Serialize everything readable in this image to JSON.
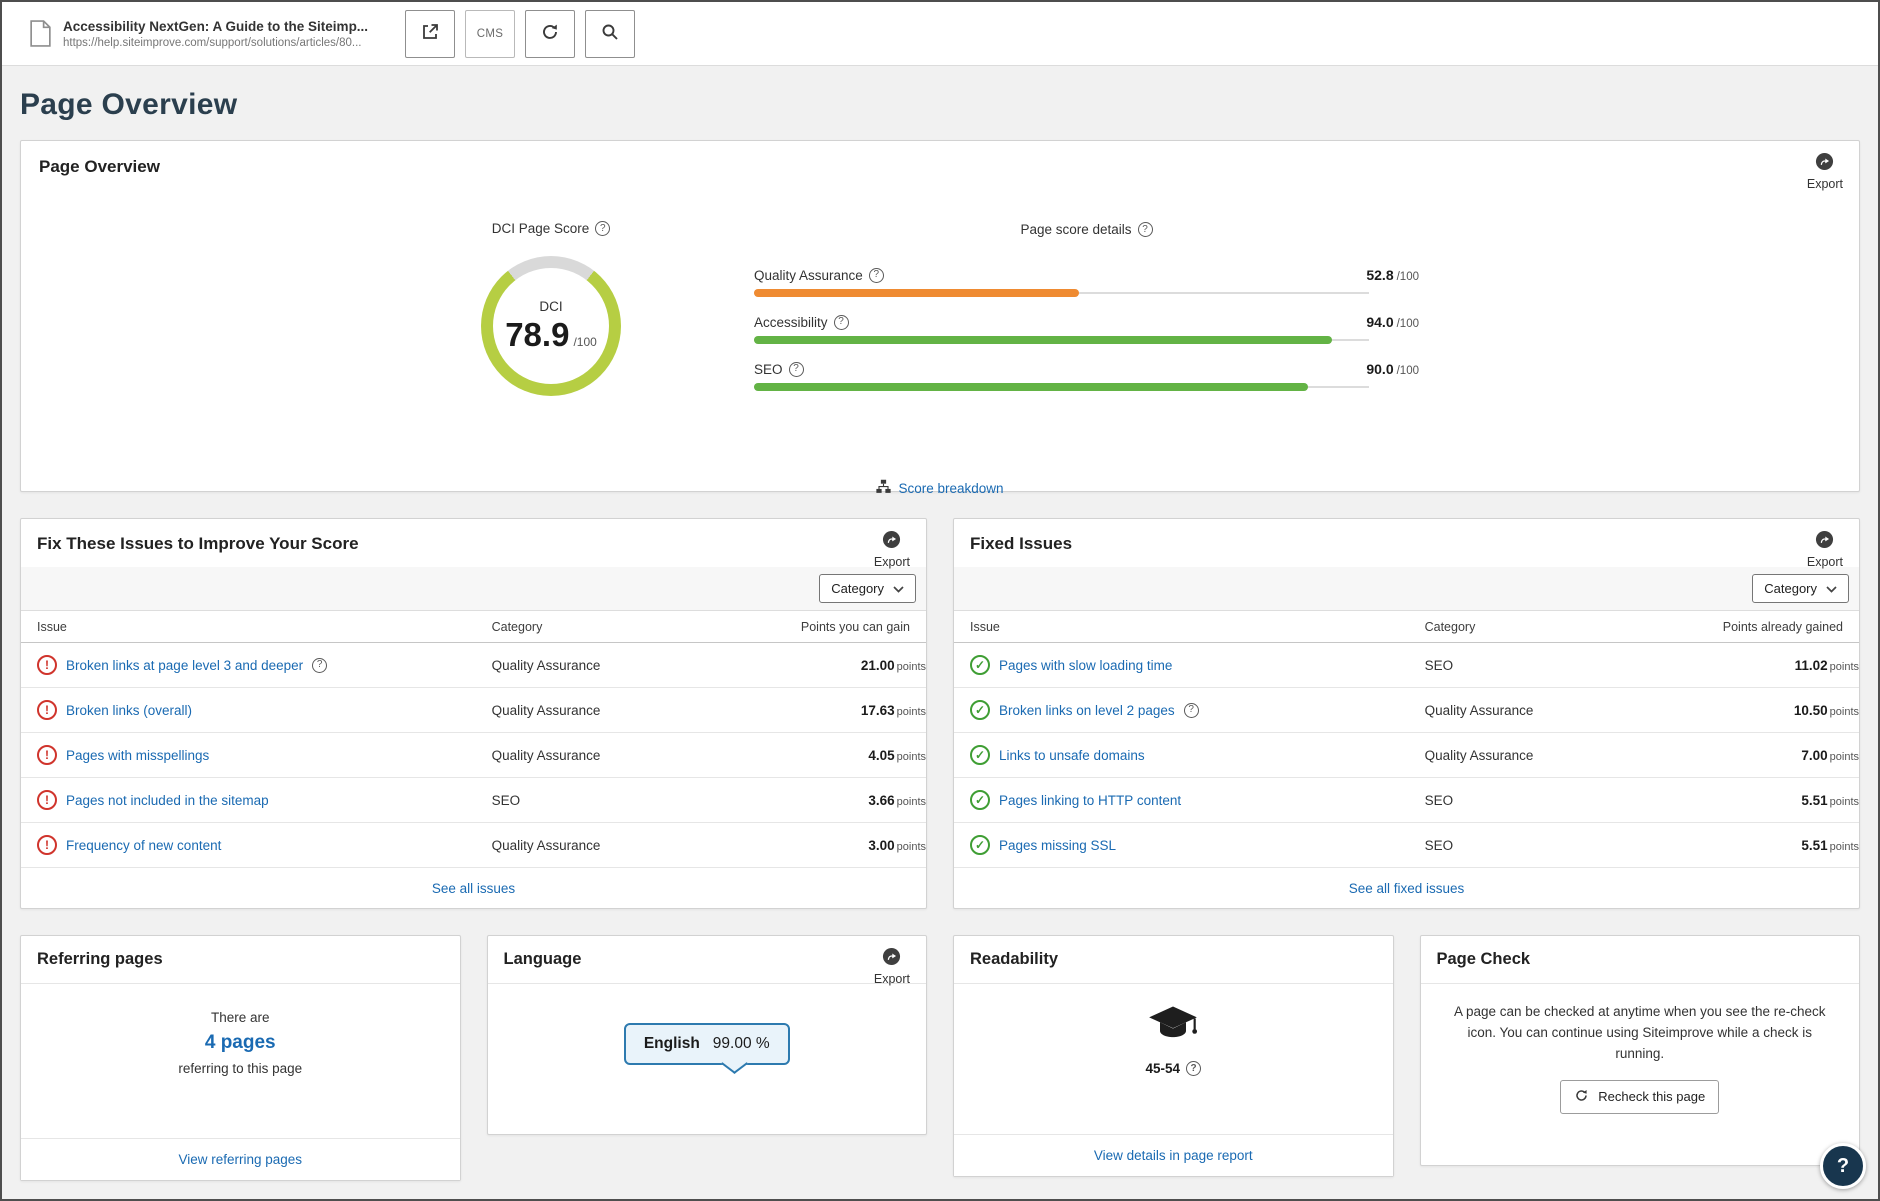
{
  "icons": {
    "info_glyph": "?",
    "alert_glyph": "!",
    "check_glyph": "✓"
  },
  "colors": {
    "accent_green": "#b6ce43",
    "donut_rest": "#d9d9d9",
    "bar_orange": "#ef8b32",
    "bar_green": "#63b345",
    "link_blue": "#1a6ab2"
  },
  "topbar": {
    "page_title": "Accessibility NextGen: A Guide to the Siteimp...",
    "page_url": "https://help.siteimprove.com/support/solutions/articles/80...",
    "cms_label": "CMS"
  },
  "page_title": "Page Overview",
  "overview": {
    "title": "Page Overview",
    "export_label": "Export",
    "dci_label": "DCI Page Score",
    "dci_name": "DCI",
    "dci_score": "78.9",
    "dci_percent": 78.9,
    "denominator": "/100",
    "details_label": "Page score details",
    "bars": [
      {
        "label": "Quality Assurance",
        "value": "52.8",
        "percent": 52.8,
        "color": "#ef8b32"
      },
      {
        "label": "Accessibility",
        "value": "94.0",
        "percent": 94.0,
        "color": "#63b345"
      },
      {
        "label": "SEO",
        "value": "90.0",
        "percent": 90.0,
        "color": "#63b345"
      }
    ],
    "score_breakdown_label": "Score breakdown"
  },
  "fix_issues": {
    "title": "Fix These Issues to Improve Your Score",
    "export_label": "Export",
    "category_filter_label": "Category",
    "columns": {
      "issue": "Issue",
      "category": "Category",
      "points": "Points you can gain"
    },
    "points_unit": "points",
    "rows": [
      {
        "issue": "Broken links at page level 3 and deeper",
        "category": "Quality Assurance",
        "points": "21.00"
      },
      {
        "issue": "Broken links (overall)",
        "category": "Quality Assurance",
        "points": "17.63"
      },
      {
        "issue": "Pages with misspellings",
        "category": "Quality Assurance",
        "points": "4.05"
      },
      {
        "issue": "Pages not included in the sitemap",
        "category": "SEO",
        "points": "3.66"
      },
      {
        "issue": "Frequency of new content",
        "category": "Quality Assurance",
        "points": "3.00"
      }
    ],
    "see_all_label": "See all issues"
  },
  "fixed_issues": {
    "title": "Fixed Issues",
    "export_label": "Export",
    "category_filter_label": "Category",
    "columns": {
      "issue": "Issue",
      "category": "Category",
      "points": "Points already gained"
    },
    "points_unit": "points",
    "rows": [
      {
        "issue": "Pages with slow loading time",
        "category": "SEO",
        "points": "11.02"
      },
      {
        "issue": "Broken links on level 2 pages",
        "category": "Quality Assurance",
        "points": "10.50"
      },
      {
        "issue": "Links to unsafe domains",
        "category": "Quality Assurance",
        "points": "7.00"
      },
      {
        "issue": "Pages linking to HTTP content",
        "category": "SEO",
        "points": "5.51"
      },
      {
        "issue": "Pages missing SSL",
        "category": "SEO",
        "points": "5.51"
      }
    ],
    "see_all_label": "See all fixed issues"
  },
  "referring": {
    "title": "Referring pages",
    "prefix": "There are",
    "count_link": "4 pages",
    "suffix": "referring to this page",
    "footer_link": "View referring pages"
  },
  "language": {
    "title": "Language",
    "export_label": "Export",
    "name": "English",
    "percent": "99.00 %"
  },
  "readability": {
    "title": "Readability",
    "score": "45-54",
    "footer_link": "View details in page report"
  },
  "page_check": {
    "title": "Page Check",
    "description": "A page can be checked at anytime when you see the re-check icon. You can continue using Siteimprove while a check is running.",
    "button_label": "Recheck this page"
  },
  "help": {
    "label": "?"
  }
}
